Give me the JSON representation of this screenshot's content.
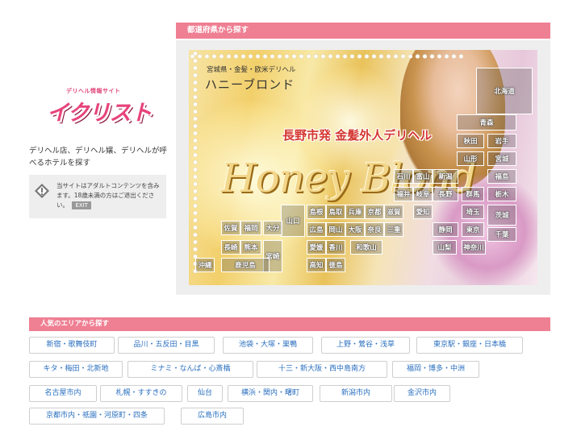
{
  "site": {
    "logo_sub": "デリヘル情報サイト",
    "logo_main": "イクリスト",
    "tagline": "デリヘル店、デリヘル嬢、デリヘルが呼べるホテルを探す",
    "notice_text": "当サイトはアダルトコンテンツを含みます。18歳未満の方はご退出ください。",
    "exit_label": "EXIT"
  },
  "prefecture_section": {
    "heading": "都道府県から探す",
    "banner": {
      "subtitle": "宮城県・金髪・欧米デリヘル",
      "title": "ハニーブロンド",
      "catch": "長野市発 金髪外人デリヘル",
      "script": "Honey Blond"
    },
    "prefectures": [
      {
        "name": "北海道",
        "key": "hokkaido"
      },
      {
        "name": "青森",
        "key": "aomori"
      },
      {
        "name": "秋田",
        "key": "akita"
      },
      {
        "name": "岩手",
        "key": "iwate"
      },
      {
        "name": "山形",
        "key": "yamagata"
      },
      {
        "name": "宮城",
        "key": "miyagi"
      },
      {
        "name": "石川",
        "key": "ishikawa"
      },
      {
        "name": "富山",
        "key": "toyama"
      },
      {
        "name": "新潟",
        "key": "niigata"
      },
      {
        "name": "福島",
        "key": "fukushima"
      },
      {
        "name": "福井",
        "key": "fukui"
      },
      {
        "name": "岐阜",
        "key": "gifu"
      },
      {
        "name": "長野",
        "key": "nagano"
      },
      {
        "name": "群馬",
        "key": "gunma"
      },
      {
        "name": "栃木",
        "key": "tochigi"
      },
      {
        "name": "島根",
        "key": "shimane"
      },
      {
        "name": "鳥取",
        "key": "tottori"
      },
      {
        "name": "兵庫",
        "key": "hyogo"
      },
      {
        "name": "京都",
        "key": "kyoto"
      },
      {
        "name": "滋賀",
        "key": "shiga"
      },
      {
        "name": "愛知",
        "key": "aichi"
      },
      {
        "name": "埼玉",
        "key": "saitama"
      },
      {
        "name": "茨城",
        "key": "ibaraki"
      },
      {
        "name": "山口",
        "key": "yamaguchi"
      },
      {
        "name": "佐賀",
        "key": "saga"
      },
      {
        "name": "福岡",
        "key": "fukuoka"
      },
      {
        "name": "大分",
        "key": "oita"
      },
      {
        "name": "広島",
        "key": "hiroshima"
      },
      {
        "name": "岡山",
        "key": "okayama"
      },
      {
        "name": "大阪",
        "key": "osaka"
      },
      {
        "name": "奈良",
        "key": "nara"
      },
      {
        "name": "三重",
        "key": "mie"
      },
      {
        "name": "静岡",
        "key": "shizuoka"
      },
      {
        "name": "山梨",
        "key": "yamanashi"
      },
      {
        "name": "東京",
        "key": "tokyo"
      },
      {
        "name": "千葉",
        "key": "chiba"
      },
      {
        "name": "長崎",
        "key": "nagasaki"
      },
      {
        "name": "熊本",
        "key": "kumamoto"
      },
      {
        "name": "宮崎",
        "key": "miyazaki"
      },
      {
        "name": "愛媛",
        "key": "ehime"
      },
      {
        "name": "香川",
        "key": "kagawa"
      },
      {
        "name": "和歌山",
        "key": "wakayama"
      },
      {
        "name": "神奈川",
        "key": "kanagawa"
      },
      {
        "name": "高知",
        "key": "kochi"
      },
      {
        "name": "徳島",
        "key": "tokushima"
      },
      {
        "name": "沖縄",
        "key": "okinawa"
      },
      {
        "name": "鹿児島",
        "key": "kagoshima"
      }
    ]
  },
  "popular_section": {
    "heading": "人気のエリアから探す",
    "areas": [
      "新宿・歌舞伎町",
      "品川・五反田・目黒",
      "池袋・大塚・巣鴨",
      "上野・鶯谷・浅草",
      "東京駅・銀座・日本橋",
      "キタ・梅田・北新地",
      "ミナミ・なんば・心斎橋",
      "十三・新大阪・西中島南方",
      "福岡・博多・中洲",
      "名古屋市内",
      "札幌・すすきの",
      "仙台",
      "横浜・関内・曙町",
      "新潟市内",
      "金沢市内",
      "京都市内・祇園・河原町・四条",
      "広島市内"
    ]
  }
}
